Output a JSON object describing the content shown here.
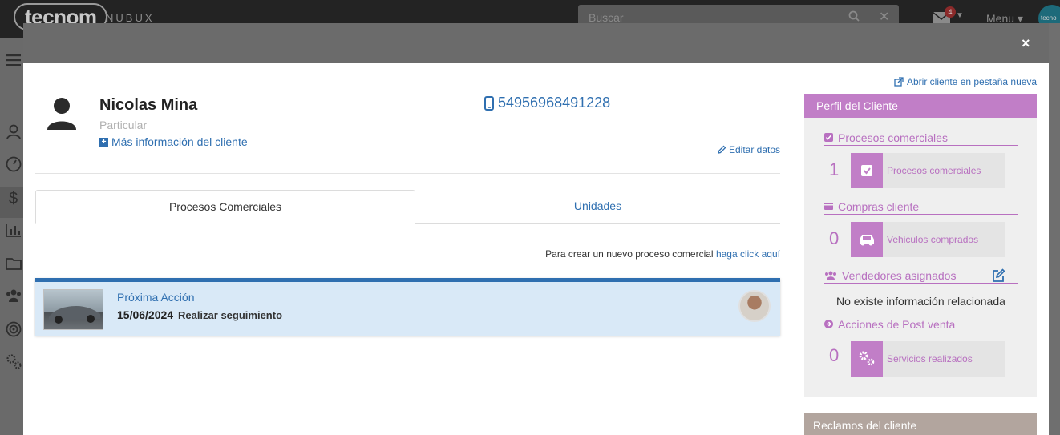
{
  "navbar": {
    "brand": "tecnom",
    "brand_sub": "NUBUX",
    "search_placeholder": "Buscar",
    "mail_count": "4",
    "menu_label": "Menu",
    "user_avatar_text": "tecno"
  },
  "modal": {
    "close_label": "×"
  },
  "client": {
    "name": "Nicolas Mina",
    "type": "Particular",
    "more_info": "Más información del cliente",
    "phone": "54956968491228",
    "edit": "Editar datos",
    "open_new_tab": "Abrir cliente en pestaña nueva"
  },
  "tabs": [
    {
      "label": "Procesos Comerciales",
      "active": true
    },
    {
      "label": "Unidades",
      "active": false
    }
  ],
  "create_process": {
    "text": "Para crear un nuevo proceso comercial",
    "link": "haga click aquí"
  },
  "process_card": {
    "title": "Próxima Acción",
    "date": "15/06/2024",
    "action": "Realizar seguimiento"
  },
  "profile": {
    "title": "Perfil del Cliente",
    "sections": {
      "commercial": {
        "title": "Procesos comerciales",
        "count": "1",
        "box_label": "Procesos comerciales"
      },
      "purchases": {
        "title": "Compras cliente",
        "count": "0",
        "box_label": "Vehiculos comprados"
      },
      "sellers": {
        "title": "Vendedores asignados",
        "empty_text": "No existe información relacionada"
      },
      "aftersales": {
        "title": "Acciones de Post venta",
        "count": "0",
        "box_label": "Servicios realizados"
      }
    },
    "claims_title": "Reclamos del cliente"
  },
  "colors": {
    "accent_blue": "#2f6fb0",
    "profile_purple": "#c17ec7",
    "claims_tan": "#b2a59e",
    "card_bg": "#d9e9f7"
  }
}
